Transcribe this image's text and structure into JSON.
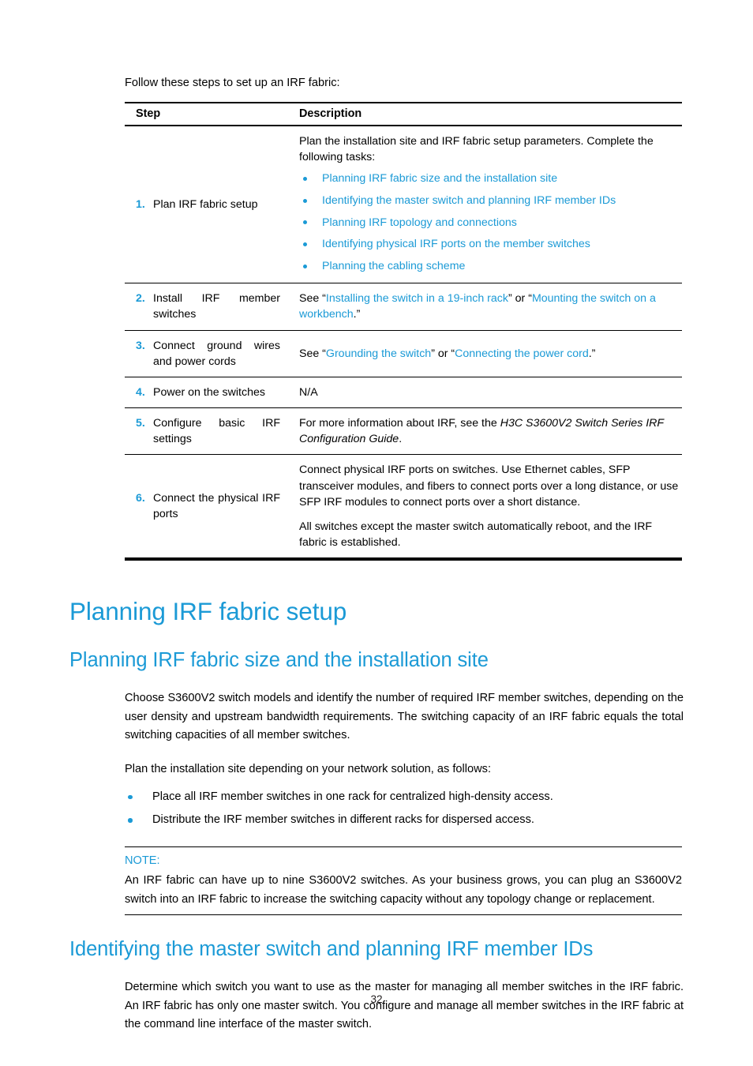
{
  "document": {
    "intro": "Follow these steps to set up an IRF fabric:",
    "page_number": "32",
    "accent_color": "#1b9ad6"
  },
  "table": {
    "headers": {
      "step": "Step",
      "description": "Description"
    },
    "rows": [
      {
        "num": "1.",
        "label": "Plan IRF fabric setup",
        "label_spread": false,
        "desc_intro": "Plan the installation site and IRF fabric setup parameters. Complete the following tasks:",
        "links": [
          "Planning IRF fabric size and the installation site",
          "Identifying the master switch and planning IRF member IDs",
          "Planning IRF topology and connections",
          "Identifying physical IRF ports on the member switches",
          "Planning the cabling scheme"
        ]
      },
      {
        "num": "2.",
        "label_spread_line": "Install      IRF      member",
        "label_last_line": "switches",
        "label_spread": true,
        "desc_parts": [
          {
            "t": "See “",
            "k": "plain"
          },
          {
            "t": "Installing the switch in a 19-inch rack",
            "k": "link"
          },
          {
            "t": "” or “",
            "k": "plain"
          },
          {
            "t": "Mounting the switch on a workbench",
            "k": "link"
          },
          {
            "t": ".”",
            "k": "plain"
          }
        ]
      },
      {
        "num": "3.",
        "label_spread_line": "Connect   ground   wires",
        "label_last_line": "and power cords",
        "label_spread": true,
        "desc_parts": [
          {
            "t": "See “",
            "k": "plain"
          },
          {
            "t": "Grounding the switch",
            "k": "link"
          },
          {
            "t": "” or “",
            "k": "plain"
          },
          {
            "t": "Connecting the power cord",
            "k": "link"
          },
          {
            "t": ".”",
            "k": "plain"
          }
        ]
      },
      {
        "num": "4.",
        "label": "Power on the switches",
        "label_spread": false,
        "desc_plain": "N/A"
      },
      {
        "num": "5.",
        "label_spread_line": "Configure     basic     IRF",
        "label_last_line": "settings",
        "label_spread": true,
        "desc_parts": [
          {
            "t": "For more information about IRF, see the ",
            "k": "plain"
          },
          {
            "t": "H3C S3600V2 Switch Series IRF Configuration Guide",
            "k": "italic"
          },
          {
            "t": ".",
            "k": "plain"
          }
        ]
      },
      {
        "num": "6.",
        "label_spread_line": "Connect the physical IRF",
        "label_last_line": "ports",
        "label_spread": true,
        "desc_paragraphs": [
          "Connect physical IRF ports on switches. Use Ethernet cables, SFP transceiver modules, and fibers to connect ports over a long distance, or use SFP IRF modules to connect ports over a short distance.",
          "All switches except the master switch automatically reboot, and the IRF fabric is established."
        ]
      }
    ]
  },
  "sections": {
    "h1": "Planning IRF fabric setup",
    "h2_a": "Planning IRF fabric size and the installation site",
    "para_a1": "Choose S3600V2 switch models and identify the number of required IRF member switches, depending on the user density and upstream bandwidth requirements. The switching capacity of an IRF fabric equals the total switching capacities of all member switches.",
    "para_a2": "Plan the installation site depending on your network solution, as follows:",
    "bullets_a": [
      "Place all IRF member switches in one rack for centralized high-density access.",
      "Distribute the IRF member switches in different racks for dispersed access."
    ],
    "note_title": "NOTE:",
    "note_body": "An IRF fabric can have up to nine S3600V2 switches. As your business grows, you can plug an S3600V2 switch into an IRF fabric to increase the switching capacity without any topology change or replacement.",
    "h2_b": "Identifying the master switch and planning IRF member IDs",
    "para_b1": "Determine which switch you want to use as the master for managing all member switches in the IRF fabric. An IRF fabric has only one master switch. You configure and manage all member switches in the IRF fabric at the command line interface of the master switch."
  }
}
